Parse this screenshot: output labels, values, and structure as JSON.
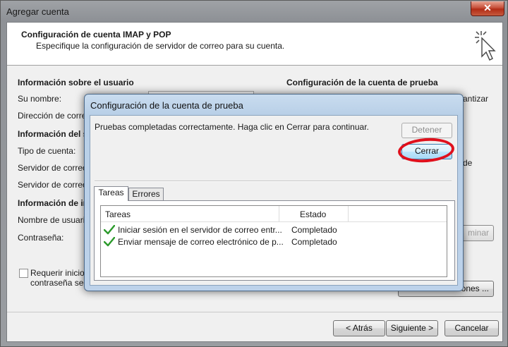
{
  "window": {
    "title": "Agregar cuenta",
    "close_glyph": "✕"
  },
  "header": {
    "title": "Configuración de cuenta IMAP y POP",
    "subtitle": "Especifique la configuración de servidor de correo para su cuenta.",
    "icon": "cursor-click-icon"
  },
  "background": {
    "user_info_title": "Información sobre el usuario",
    "name_label": "Su nombre:",
    "email_label": "Dirección de correo",
    "server_info_title": "Información del se",
    "account_type_label": "Tipo de cuenta:",
    "incoming_server_label": "Servidor de correo",
    "outgoing_server_label": "Servidor de correo",
    "login_info_title": "Información de ini",
    "username_label": "Nombre de usuario",
    "password_label": "Contraseña:",
    "test_title": "Configuración de la cuenta de prueba",
    "right_fragment_1": "antizar",
    "right_fragment_2": "de",
    "secure_password_line1": "Requerir inicio",
    "secure_password_line2": "contraseña seg",
    "remove_button_fragment": "minar",
    "more_settings_fragment": "ones ..."
  },
  "footer": {
    "back_label": "< Atrás",
    "next_label": "Siguiente >",
    "cancel_label": "Cancelar"
  },
  "dialog": {
    "title": "Configuración de la cuenta de prueba",
    "message": "Pruebas completadas correctamente. Haga clic en Cerrar para continuar.",
    "stop_label": "Detener",
    "close_label": "Cerrar",
    "tabs": [
      {
        "label": "Tareas",
        "active": true
      },
      {
        "label": "Errores",
        "active": false
      }
    ],
    "columns": {
      "task": "Tareas",
      "status": "Estado"
    },
    "rows": [
      {
        "task": "Iniciar sesión en el servidor de correo entr...",
        "status": "Completado",
        "icon": "green-check-icon"
      },
      {
        "task": "Enviar mensaje de correo electrónico de p...",
        "status": "Completado",
        "icon": "green-check-icon"
      }
    ],
    "highlight_color": "#e0101c"
  }
}
